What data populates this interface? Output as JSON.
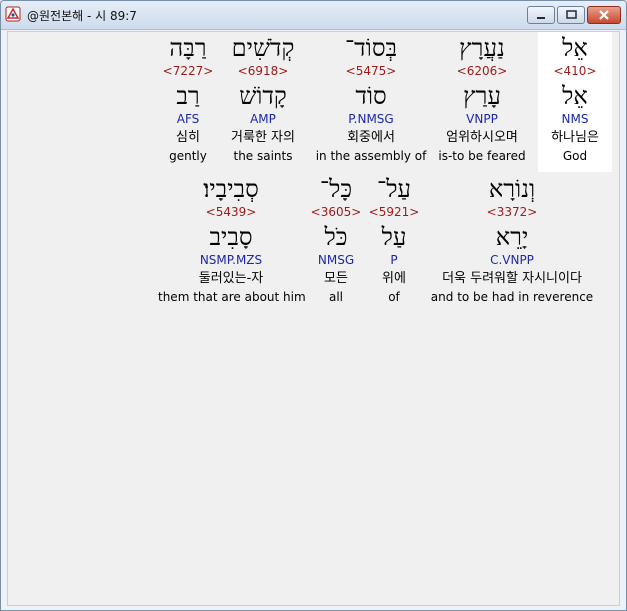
{
  "window": {
    "title": "@원전본해 - 시 89:7"
  },
  "words": [
    {
      "hebrew": "אֵל",
      "strong": "<410>",
      "lemma": "אֵל",
      "morph": "NMS",
      "korean": "하나님은",
      "english": "God",
      "highlighted": true
    },
    {
      "hebrew": "נַעֲרָץ",
      "strong": "<6206>",
      "lemma": "עָרַץ",
      "morph": "VNPP",
      "korean": "엄위하시오며",
      "english": "is-to be feared",
      "highlighted": false
    },
    {
      "hebrew": "בְּסוֹד־",
      "strong": "<5475>",
      "lemma": "סוֹד",
      "morph": "P.NMSG",
      "korean": "회중에서",
      "english": "in the assembly of",
      "highlighted": false
    },
    {
      "hebrew": "קְדֹשִׁים",
      "strong": "<6918>",
      "lemma": "קָדוֹשׁ",
      "morph": "AMP",
      "korean": "거룩한 자의",
      "english": "the saints",
      "highlighted": false
    },
    {
      "hebrew": "רַבָּה",
      "strong": "<7227>",
      "lemma": "רַב",
      "morph": "AFS",
      "korean": "심히",
      "english": "gently",
      "highlighted": false
    },
    {
      "hebrew": "וְנוֹרָא",
      "strong": "<3372>",
      "lemma": "יָרֵא",
      "morph": "C.VNPP",
      "korean": "더욱 두려워할 자시니이다",
      "english": "and to be had in reverence",
      "highlighted": false
    },
    {
      "hebrew": "עַל־",
      "strong": "<5921>",
      "lemma": "עַל",
      "morph": "P",
      "korean": "위에",
      "english": "of",
      "highlighted": false
    },
    {
      "hebrew": "כָּל־",
      "strong": "<3605>",
      "lemma": "כֹּל",
      "morph": "NMSG",
      "korean": "모든",
      "english": "all",
      "highlighted": false
    },
    {
      "hebrew": "סְבִיבָיו׃",
      "strong": "<5439>",
      "lemma": "סָבִיב",
      "morph": "NSMP.MZS",
      "korean": "둘러있는-자",
      "english": "them that are about him",
      "highlighted": false
    }
  ]
}
